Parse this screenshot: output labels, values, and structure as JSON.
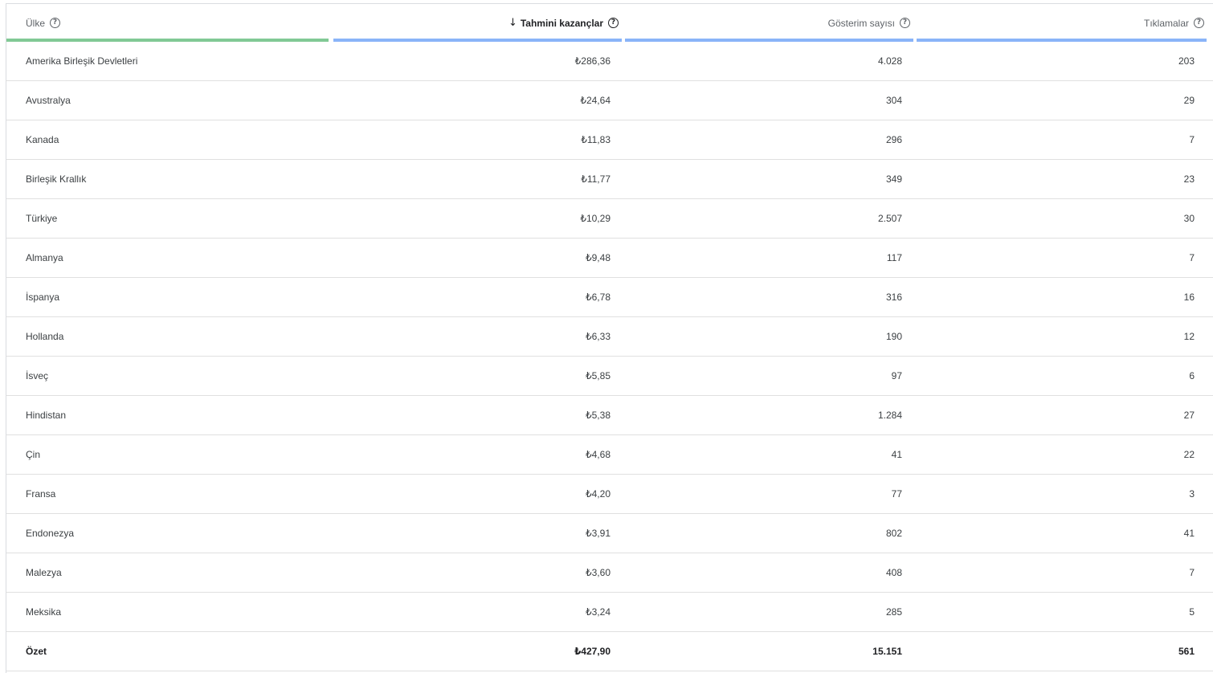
{
  "table": {
    "headers": {
      "country": "Ülke",
      "earnings": "Tahmini kazançlar",
      "impressions": "Gösterim sayısı",
      "clicks": "Tıklamalar"
    },
    "sort": {
      "column": "earnings",
      "direction": "descending",
      "icon": "arrow-down-icon"
    },
    "bar_colors": {
      "dimension": "#81c995",
      "metric": "#8ab4f8"
    },
    "rows": [
      {
        "country": "Amerika Birleşik Devletleri",
        "earnings": "₺286,36",
        "impressions": "4.028",
        "clicks": "203"
      },
      {
        "country": "Avustralya",
        "earnings": "₺24,64",
        "impressions": "304",
        "clicks": "29"
      },
      {
        "country": "Kanada",
        "earnings": "₺11,83",
        "impressions": "296",
        "clicks": "7"
      },
      {
        "country": "Birleşik Krallık",
        "earnings": "₺11,77",
        "impressions": "349",
        "clicks": "23"
      },
      {
        "country": "Türkiye",
        "earnings": "₺10,29",
        "impressions": "2.507",
        "clicks": "30"
      },
      {
        "country": "Almanya",
        "earnings": "₺9,48",
        "impressions": "117",
        "clicks": "7"
      },
      {
        "country": "İspanya",
        "earnings": "₺6,78",
        "impressions": "316",
        "clicks": "16"
      },
      {
        "country": "Hollanda",
        "earnings": "₺6,33",
        "impressions": "190",
        "clicks": "12"
      },
      {
        "country": "İsveç",
        "earnings": "₺5,85",
        "impressions": "97",
        "clicks": "6"
      },
      {
        "country": "Hindistan",
        "earnings": "₺5,38",
        "impressions": "1.284",
        "clicks": "27"
      },
      {
        "country": "Çin",
        "earnings": "₺4,68",
        "impressions": "41",
        "clicks": "22"
      },
      {
        "country": "Fransa",
        "earnings": "₺4,20",
        "impressions": "77",
        "clicks": "3"
      },
      {
        "country": "Endonezya",
        "earnings": "₺3,91",
        "impressions": "802",
        "clicks": "41"
      },
      {
        "country": "Malezya",
        "earnings": "₺3,60",
        "impressions": "408",
        "clicks": "7"
      },
      {
        "country": "Meksika",
        "earnings": "₺3,24",
        "impressions": "285",
        "clicks": "5"
      }
    ],
    "summary": {
      "label": "Özet",
      "earnings": "₺427,90",
      "impressions": "15.151",
      "clicks": "561"
    }
  }
}
